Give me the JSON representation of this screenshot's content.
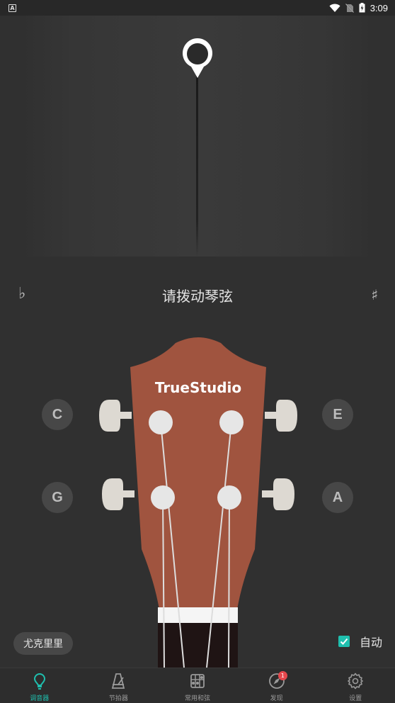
{
  "status_bar": {
    "time": "3:09",
    "app_indicator": "A",
    "icons": [
      "wifi-icon",
      "no-sim-icon",
      "battery-charging-icon"
    ]
  },
  "tuner": {
    "flat_symbol": "♭",
    "sharp_symbol": "♯",
    "prompt": "请拨动琴弦",
    "brand": "TrueStudio",
    "strings": {
      "left_top": "C",
      "right_top": "E",
      "left_bottom": "G",
      "right_bottom": "A"
    },
    "instrument": "尤克里里",
    "auto_label": "自动",
    "auto_checked": true,
    "colors": {
      "accent": "#1fbfae",
      "headstock": "#a0543f",
      "background": "#303030"
    }
  },
  "nav": {
    "tabs": [
      {
        "label": "调音器",
        "icon": "tuner-icon",
        "active": true
      },
      {
        "label": "节拍器",
        "icon": "metronome-icon",
        "active": false
      },
      {
        "label": "常用和弦",
        "icon": "chord-icon",
        "active": false
      },
      {
        "label": "发现",
        "icon": "compass-icon",
        "active": false,
        "badge": "1"
      },
      {
        "label": "设置",
        "icon": "settings-icon",
        "active": false
      }
    ]
  }
}
